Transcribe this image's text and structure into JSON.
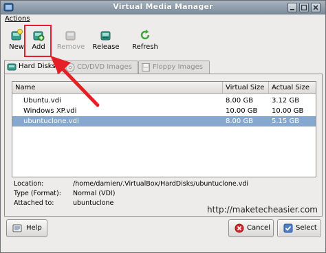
{
  "window": {
    "title": "Virtual Media Manager"
  },
  "menubar": {
    "actions": "Actions"
  },
  "toolbar": {
    "new": "New",
    "add": "Add",
    "remove": "Remove",
    "release": "Release",
    "refresh": "Refresh"
  },
  "tabs": [
    {
      "label": "Hard Disks",
      "active": true
    },
    {
      "label": "CD/DVD Images",
      "active": false
    },
    {
      "label": "Floppy Images",
      "active": false
    }
  ],
  "table": {
    "headers": [
      "Name",
      "Virtual Size",
      "Actual Size"
    ],
    "rows": [
      {
        "name": "Ubuntu.vdi",
        "virtual": "8.00 GB",
        "actual": "3.12 GB",
        "selected": false
      },
      {
        "name": "Windows XP.vdi",
        "virtual": "10.00 GB",
        "actual": "10.00 GB",
        "selected": false
      },
      {
        "name": "ubuntuclone.vdi",
        "virtual": "8.00 GB",
        "actual": "5.15 GB",
        "selected": true
      }
    ]
  },
  "details": {
    "location_label": "Location:",
    "location_value": "/home/damien/.VirtualBox/HardDisks/ubuntuclone.vdi",
    "type_label": "Type (Format):",
    "type_value": "Normal (VDI)",
    "attached_label": "Attached to:",
    "attached_value": "ubuntuclone"
  },
  "watermark": "http://maketecheasier.com",
  "buttons": {
    "help": "Help",
    "cancel": "Cancel",
    "select": "Select"
  },
  "colors": {
    "selection": "#86a8cf",
    "annotation_red": "#e61e25"
  }
}
